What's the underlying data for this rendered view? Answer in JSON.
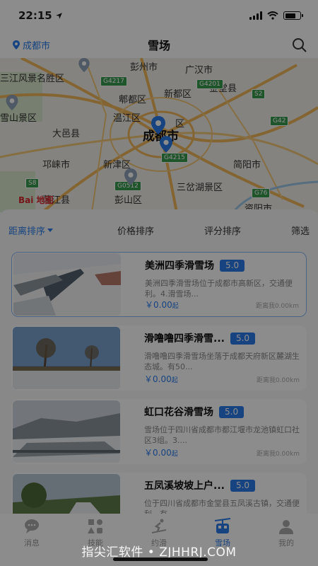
{
  "status": {
    "time": "22:15"
  },
  "nav": {
    "city": "成都市",
    "title": "雪场"
  },
  "map": {
    "labels": [
      "三江风景名胜区",
      "彭州市",
      "广汉市",
      "郫都区",
      "新都区",
      "金堂县",
      "雪山景区",
      "温江区",
      "区",
      "大邑县",
      "成都市",
      "邛崃市",
      "新津区",
      "简阳市",
      "蒲江县",
      "彭山区",
      "三岔湖景区",
      "资阳市"
    ],
    "roads": [
      "G4217",
      "G4201",
      "S2",
      "G42",
      "G4215",
      "S8",
      "G0512",
      "G76"
    ],
    "logo": "Bai 地图"
  },
  "sort": {
    "items": [
      "距离排序",
      "价格排序",
      "评分排序",
      "筛选"
    ]
  },
  "resorts": [
    {
      "name": "美洲四季滑雪场",
      "rating": "5.0",
      "desc": "美洲四季滑雪场位于成都市高新区，交通便利。4.滑雪场...",
      "price": "￥0.00",
      "unit": "起",
      "distance": "距离我0.00km"
    },
    {
      "name": "滑噜噜四季滑雪...",
      "rating": "5.0",
      "desc": "滑噜噜四季滑雪场坐落于成都天府新区麓湖生态城。有50...",
      "price": "￥0.00",
      "unit": "起",
      "distance": "距离我0.00km"
    },
    {
      "name": "虹口花谷滑雪场",
      "rating": "5.0",
      "desc": "雪场位于四川省成都市都江堰市龙池镇虹口社区3组。3....",
      "price": "￥0.00",
      "unit": "起",
      "distance": "距离我0.00km"
    },
    {
      "name": "五凤溪坡坡上户...",
      "rating": "5.0",
      "desc": "位于四川省成都市金堂县五凤溪古镇，交通便利，有...",
      "price": "",
      "unit": "",
      "distance": ""
    }
  ],
  "tabs": [
    {
      "label": "消息",
      "icon": "chat-icon"
    },
    {
      "label": "技能",
      "icon": "skills-icon"
    },
    {
      "label": "约滑",
      "icon": "ski-person-icon"
    },
    {
      "label": "雪场",
      "icon": "cable-car-icon"
    },
    {
      "label": "我的",
      "icon": "profile-icon"
    }
  ],
  "watermark": "指尖汇软件 • ZJHHRJ.COM",
  "colors": {
    "accent": "#2b7de9",
    "road_badge": "#3a9b4f"
  }
}
